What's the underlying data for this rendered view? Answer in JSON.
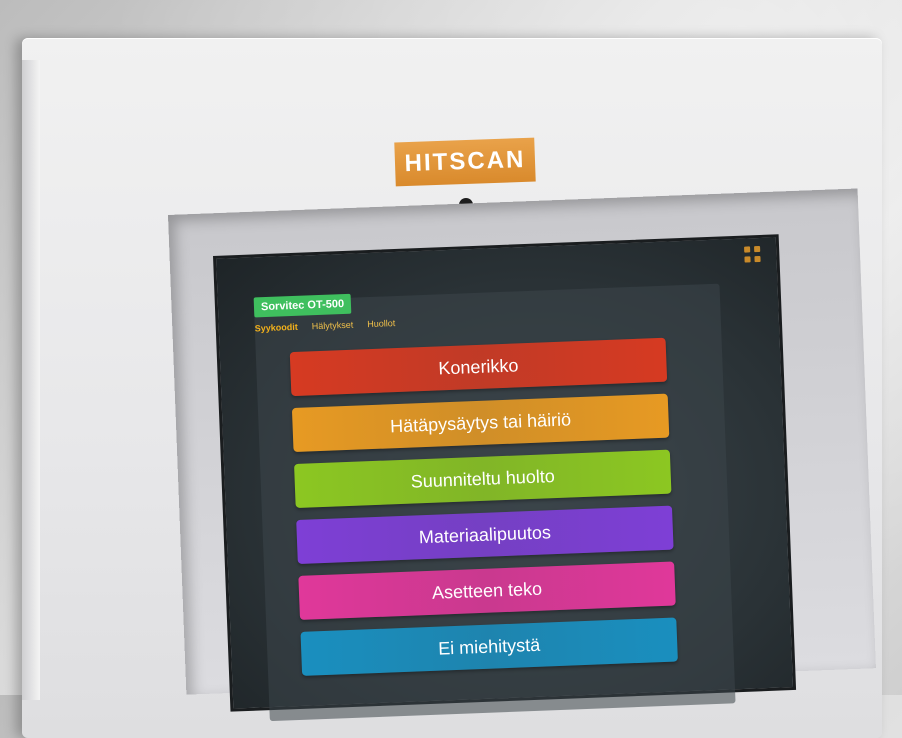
{
  "logo": {
    "text": "HITSCAN",
    "color": "#e09a3c"
  },
  "device": {
    "badge": "Sorvitec OT-500",
    "badge_color": "#3fbf5e"
  },
  "tabs": [
    {
      "label": "Syykoodit",
      "active": true
    },
    {
      "label": "Hälytykset",
      "active": false
    },
    {
      "label": "Huollot",
      "active": false
    }
  ],
  "buttons": [
    {
      "label": "Konerikko",
      "color": "#d63a22"
    },
    {
      "label": "Hätäpysäytys tai häiriö",
      "color": "#e79a23"
    },
    {
      "label": "Suunniteltu huolto",
      "color": "#8cc722"
    },
    {
      "label": "Materiaalipuutos",
      "color": "#7e3fd6"
    },
    {
      "label": "Asetteen teko",
      "color": "#e0389a"
    },
    {
      "label": "Ei miehitystä",
      "color": "#1a8fbf"
    }
  ],
  "icons": {
    "menu": "grid-icon",
    "camera": "camera-icon"
  }
}
